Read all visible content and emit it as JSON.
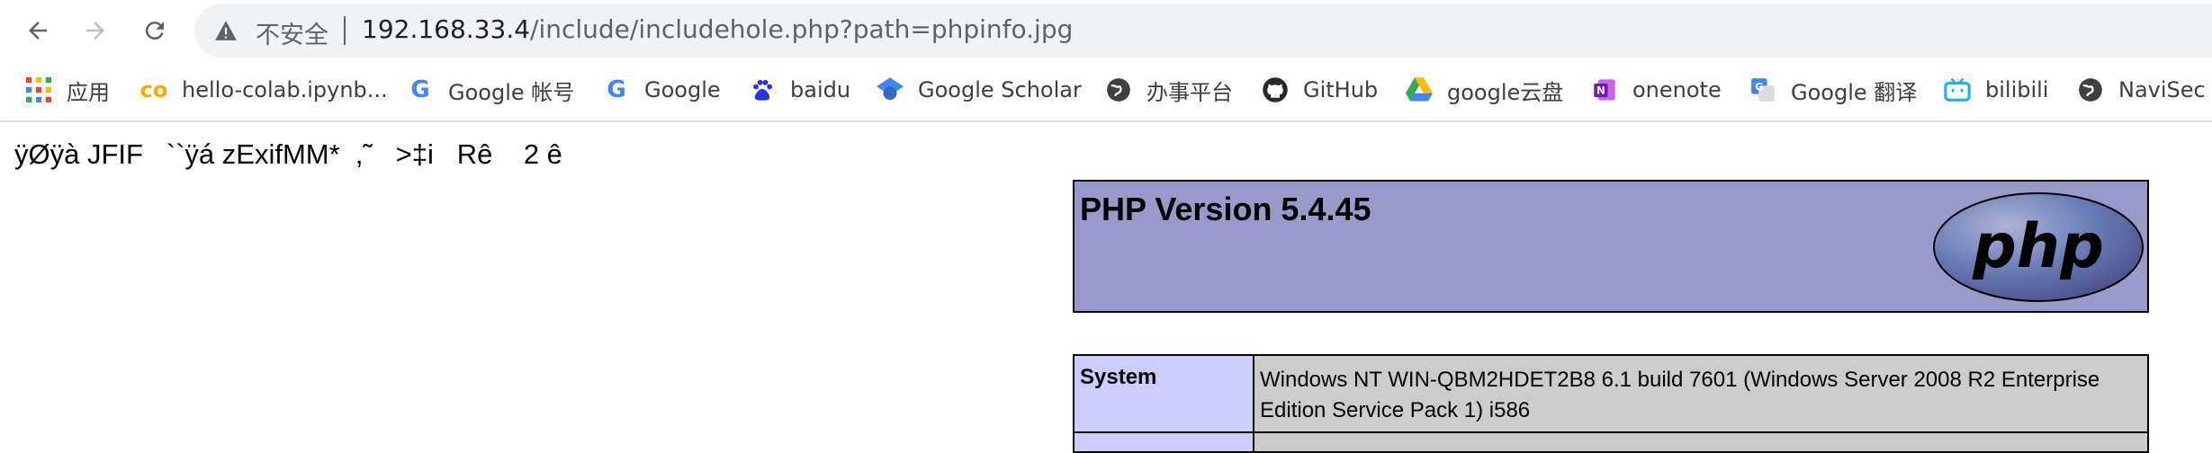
{
  "toolbar": {
    "back_icon": "arrow-left-icon",
    "forward_icon": "arrow-right-icon",
    "reload_icon": "reload-icon",
    "security_label": "不安全",
    "url_host": "192.168.33.4",
    "url_path": "/include/includehole.php?path=phpinfo.jpg"
  },
  "bookmarks": [
    {
      "label": "应用",
      "icon": "apps-grid-icon"
    },
    {
      "label": "hello-colab.ipynb...",
      "icon": "colab-icon"
    },
    {
      "label": "Google 帐号",
      "icon": "google-icon"
    },
    {
      "label": "Google",
      "icon": "google-icon"
    },
    {
      "label": "baidu",
      "icon": "baidu-icon"
    },
    {
      "label": "Google Scholar",
      "icon": "scholar-icon"
    },
    {
      "label": "办事平台",
      "icon": "globe-icon"
    },
    {
      "label": "GitHub",
      "icon": "github-icon"
    },
    {
      "label": "google云盘",
      "icon": "drive-icon"
    },
    {
      "label": "onenote",
      "icon": "onenote-icon"
    },
    {
      "label": "Google 翻译",
      "icon": "translate-icon"
    },
    {
      "label": "bilibili",
      "icon": "bilibili-icon"
    },
    {
      "label": "NaviSec",
      "icon": "globe-icon"
    }
  ],
  "content": {
    "garbage_text": "ÿØÿà JFIF   ``ÿá zExifMM*  ,˜   >‡i   Rê    2 ê",
    "php_title": "PHP Version 5.4.45",
    "php_logo_text": "php",
    "system_key": "System",
    "system_value": "Windows NT WIN-QBM2HDET2B8 6.1 build 7601 (Windows Server 2008 R2 Enterprise Edition Service Pack 1) i586"
  },
  "colors": {
    "php_header_bg": "#9999cc",
    "php_key_bg": "#ccccff",
    "php_value_bg": "#cccccc"
  }
}
